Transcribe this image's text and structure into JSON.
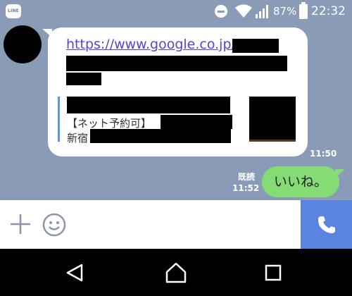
{
  "status_bar": {
    "app_badge": "LINE",
    "battery_percent": "87%",
    "battery_level": 0.87,
    "time": "22:32",
    "icons": [
      "line-app-icon",
      "do-not-disturb-icon",
      "wifi-icon",
      "signal-icon",
      "battery-icon"
    ]
  },
  "chat": {
    "incoming": {
      "url_text": "https://www.google.co.jp/",
      "preview_line_1": "【ネット予約可】",
      "preview_line_2": "新宿",
      "time": "11:50"
    },
    "outgoing": {
      "read_label": "既読",
      "time": "11:52",
      "text": "いいね。"
    }
  },
  "input_bar": {
    "icons": [
      "plus-icon",
      "emoji-icon",
      "phone-icon"
    ]
  },
  "nav_bar": {
    "icons": [
      "back-icon",
      "home-icon",
      "recents-icon"
    ]
  },
  "colors": {
    "chat_background": "#8a9bb8",
    "outgoing_bubble": "#86dc74",
    "link": "#5046d9",
    "call_button": "#5b84e0"
  }
}
